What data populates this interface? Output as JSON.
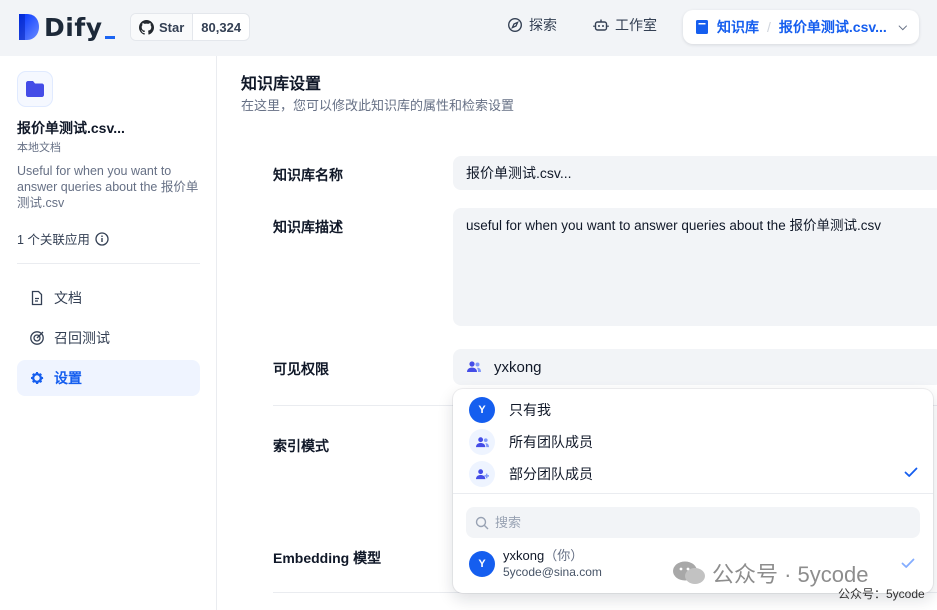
{
  "header": {
    "logo_text": "Dify",
    "github": {
      "label": "Star",
      "count": "80,324"
    },
    "nav": [
      {
        "label": "探索",
        "icon": "compass-icon"
      },
      {
        "label": "工作室",
        "icon": "robot-icon"
      }
    ],
    "breadcrumb": {
      "section": "知识库",
      "current": "报价单测试.csv..."
    }
  },
  "sidebar": {
    "dataset_name": "报价单测试.csv...",
    "dataset_type": "本地文档",
    "dataset_desc": "Useful for when you want to answer queries about the 报价单测试.csv",
    "linked_apps": "1 个关联应用",
    "menu": [
      {
        "label": "文档",
        "icon": "document-icon",
        "active": false
      },
      {
        "label": "召回测试",
        "icon": "target-icon",
        "active": false
      },
      {
        "label": "设置",
        "icon": "gear-icon",
        "active": true
      }
    ]
  },
  "main": {
    "title": "知识库设置",
    "subtitle": "在这里，您可以修改此知识库的属性和检索设置",
    "fields": {
      "name_label": "知识库名称",
      "name_value": "报价单测试.csv...",
      "desc_label": "知识库描述",
      "desc_value": "useful for when you want to answer queries about the 报价单测试.csv",
      "permission_label": "可见权限",
      "permission_value": "yxkong",
      "index_label": "索引模式",
      "embedding_label": "Embedding 模型"
    }
  },
  "permission_dropdown": {
    "options": [
      {
        "label": "只有我",
        "avatar": "Y",
        "selected": false
      },
      {
        "label": "所有团队成员",
        "avatar_icon": "team-icon",
        "selected": false
      },
      {
        "label": "部分团队成员",
        "avatar_icon": "add-member-icon",
        "selected": true
      }
    ],
    "search_placeholder": "搜索",
    "members": [
      {
        "avatar": "Y",
        "name": "yxkong",
        "tag": "（你）",
        "email": "5ycode@sina.com",
        "selected": true
      }
    ]
  },
  "watermark": {
    "main": "公众号 · 5ycode",
    "sub": "公众号：5ycode"
  },
  "colors": {
    "accent": "#155eef",
    "active_bg": "#eff4ff",
    "field_bg": "#f2f4f7"
  }
}
